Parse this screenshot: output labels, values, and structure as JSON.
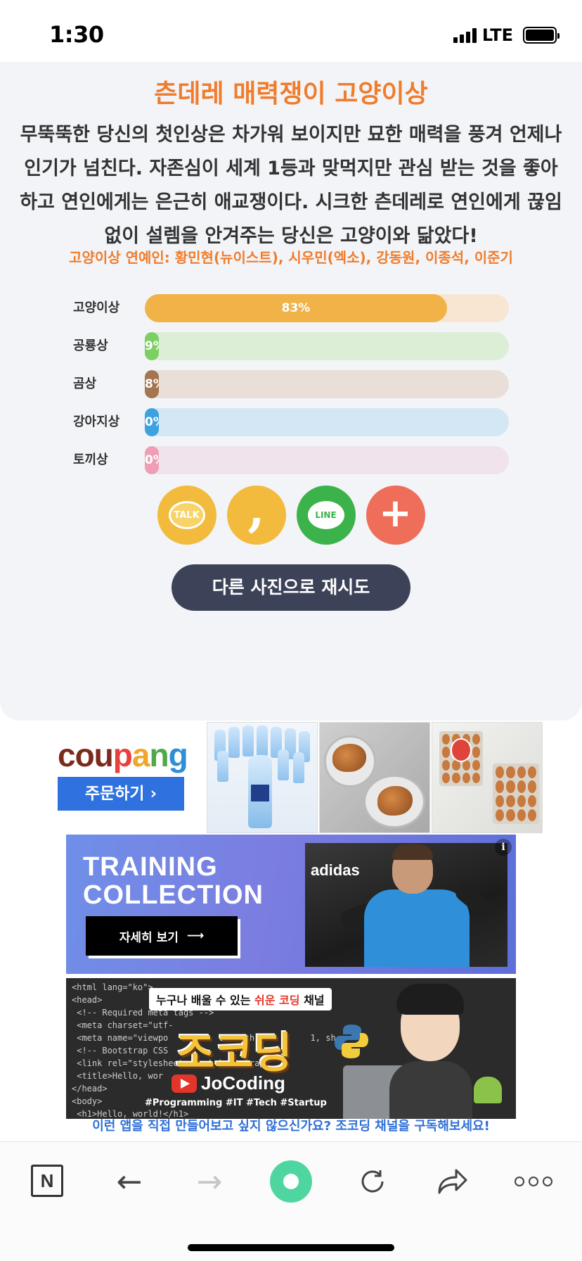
{
  "status_bar": {
    "time": "1:30",
    "network": "LTE"
  },
  "result": {
    "title": "츤데레 매력쟁이 고양이상",
    "description": "무뚝뚝한 당신의 첫인상은 차가워 보이지만 묘한 매력을 풍겨 언제나 인기가 넘친다. 자존심이 세계 1등과 맞먹지만 관심 받는 것을 좋아하고 연인에게는 은근히 애교쟁이다. 시크한 츤데레로 연인에게 끊임없이 설렘을 안겨주는 당신은 고양이와 닮았다!",
    "celebrities": "고양이상 연예인: 황민현(뉴이스트), 시우민(엑소), 강동원, 이종석, 이준기"
  },
  "results": [
    {
      "label": "고양이상",
      "percent": 83,
      "percent_text": "83%",
      "fill": "#f1b347",
      "track": "#f8e6d2"
    },
    {
      "label": "공룡상",
      "percent": 3,
      "percent_text": "9%",
      "fill": "#7ccf62",
      "track": "#dcefd6"
    },
    {
      "label": "곰상",
      "percent": 3,
      "percent_text": "8%",
      "fill": "#a57450",
      "track": "#eadfd8"
    },
    {
      "label": "강아지상",
      "percent": 2,
      "percent_text": "0%",
      "fill": "#3ea1e0",
      "track": "#d4e7f4"
    },
    {
      "label": "토끼상",
      "percent": 2,
      "percent_text": "0%",
      "fill": "#ee9fb6",
      "track": "#f1e3ec"
    }
  ],
  "share": {
    "kakaotalk_label": "TALK",
    "kakaostory_label": ",",
    "line_label": "LINE",
    "more_label": "+",
    "colors": {
      "kakaotalk": "#f2bb3d",
      "kakaostory": "#f2bb3d",
      "line": "#3bb34a",
      "more": "#ee6e5a"
    }
  },
  "retry_button": "다른 사진으로 재시도",
  "ads": {
    "coupang": {
      "order_button": "주문하기 ›"
    },
    "adidas": {
      "headline_1": "TRAINING",
      "headline_2": "COLLECTION",
      "cta": "자세히 보기",
      "brand": "adidas",
      "info": "i"
    },
    "jocoding": {
      "tagline_prefix": "누구나 배울 수 있는 ",
      "tagline_highlight": "쉬운 코딩",
      "tagline_suffix": " 채널",
      "logo": "조코딩",
      "channel_name": "JoCoding",
      "hashtags": "#Programming #IT #Tech #Startup",
      "caption": "이런 앱을 직접 만들어보고 싶지 않으신가요? 조코딩 채널을 구독해보세요!"
    }
  },
  "toolbar": {
    "n_label": "N",
    "back": "←",
    "forward": "→"
  }
}
